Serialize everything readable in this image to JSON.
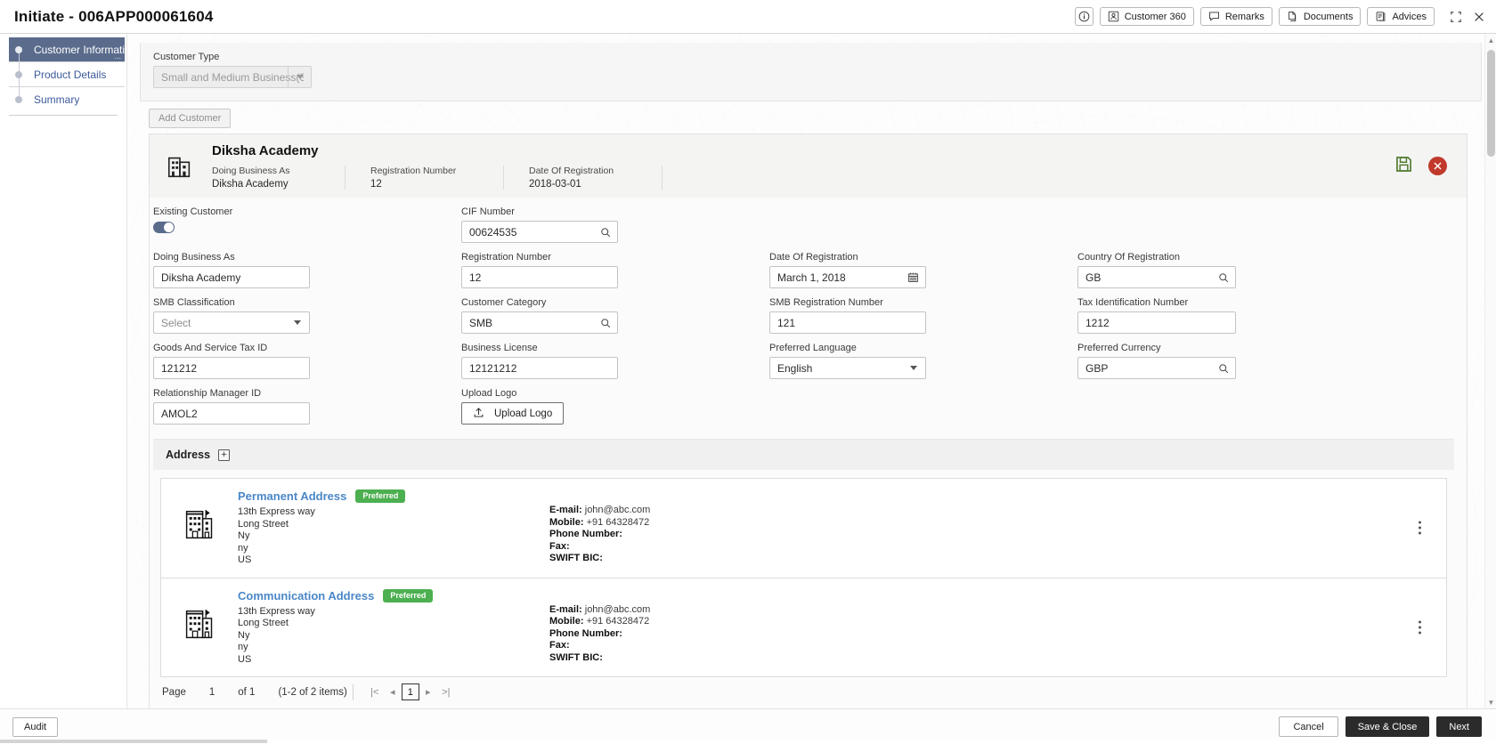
{
  "window": {
    "title": "Initiate - 006APP000061604",
    "actions": [
      {
        "label": "",
        "icon": "info-icon",
        "name": "info-button"
      },
      {
        "label": "Customer 360",
        "icon": "person-card-icon",
        "name": "customer-360-button"
      },
      {
        "label": "Remarks",
        "icon": "speech-bubble-icon",
        "name": "remarks-button"
      },
      {
        "label": "Documents",
        "icon": "documents-icon",
        "name": "documents-button"
      },
      {
        "label": "Advices",
        "icon": "clipboard-icon",
        "name": "advices-button"
      }
    ],
    "minimize_icon": "collapse-icon",
    "close_icon": "close-icon"
  },
  "sidebar": {
    "items": [
      {
        "label": "Customer Informati",
        "active": true
      },
      {
        "label": "Product Details",
        "active": false
      },
      {
        "label": "Summary",
        "active": false
      }
    ]
  },
  "form": {
    "customer_type_label": "Customer Type",
    "customer_type_value": "Small and Medium Business(S",
    "add_customer_label": "Add Customer"
  },
  "customer_card": {
    "name": "Diksha Academy",
    "meta": [
      {
        "key": "Doing Business As",
        "value": "Diksha Academy"
      },
      {
        "key": "Registration Number",
        "value": "12"
      },
      {
        "key": "Date Of Registration",
        "value": "2018-03-01"
      }
    ],
    "save_icon": "save-icon",
    "delete_icon": "delete-circle-icon",
    "fields": [
      {
        "label": "Existing Customer",
        "type": "toggle",
        "value": "on"
      },
      {
        "label": "CIF Number",
        "type": "search",
        "value": "00624535"
      },
      {
        "label": "",
        "type": "empty",
        "value": ""
      },
      {
        "label": "",
        "type": "empty",
        "value": ""
      },
      {
        "label": "Doing Business As",
        "type": "text",
        "value": "Diksha Academy"
      },
      {
        "label": "Registration Number",
        "type": "text",
        "value": "12"
      },
      {
        "label": "Date Of Registration",
        "type": "date",
        "value": "March 1, 2018"
      },
      {
        "label": "Country Of Registration",
        "type": "search",
        "value": "GB"
      },
      {
        "label": "SMB Classification",
        "type": "select",
        "value": "Select"
      },
      {
        "label": "Customer Category",
        "type": "search",
        "value": "SMB"
      },
      {
        "label": "SMB Registration Number",
        "type": "text",
        "value": "121"
      },
      {
        "label": "Tax Identification Number",
        "type": "text",
        "value": "1212"
      },
      {
        "label": "Goods And Service Tax ID",
        "type": "text",
        "value": "121212"
      },
      {
        "label": "Business License",
        "type": "text",
        "value": "12121212"
      },
      {
        "label": "Preferred Language",
        "type": "select",
        "value": "English"
      },
      {
        "label": "Preferred Currency",
        "type": "search",
        "value": "GBP"
      },
      {
        "label": "Relationship Manager ID",
        "type": "text",
        "value": "AMOL2"
      },
      {
        "label": "Upload Logo",
        "type": "upload",
        "value": "Upload Logo"
      },
      {
        "label": "",
        "type": "empty",
        "value": ""
      },
      {
        "label": "",
        "type": "empty",
        "value": ""
      }
    ]
  },
  "address": {
    "section_title": "Address",
    "add_icon": "plus-icon",
    "rows": [
      {
        "title": "Permanent Address",
        "badge": "Preferred",
        "lines": [
          "13th Express way",
          "Long Street",
          "Ny",
          "ny",
          "US"
        ],
        "contacts": [
          {
            "key": "E-mail:",
            "value": "john@abc.com"
          },
          {
            "key": "Mobile:",
            "value": "+91 64328472"
          },
          {
            "key": "Phone Number:",
            "value": ""
          },
          {
            "key": "Fax:",
            "value": ""
          },
          {
            "key": "SWIFT BIC:",
            "value": ""
          }
        ]
      },
      {
        "title": "Communication Address",
        "badge": "Preferred",
        "lines": [
          "13th Express way",
          "Long Street",
          "Ny",
          "ny",
          "US"
        ],
        "contacts": [
          {
            "key": "E-mail:",
            "value": "john@abc.com"
          },
          {
            "key": "Mobile:",
            "value": "+91 64328472"
          },
          {
            "key": "Phone Number:",
            "value": ""
          },
          {
            "key": "Fax:",
            "value": ""
          },
          {
            "key": "SWIFT BIC:",
            "value": ""
          }
        ]
      }
    ],
    "pager": {
      "page_label": "Page",
      "page_number": "1",
      "of_label": "of 1",
      "items_label": "(1-2 of 2 items)",
      "first": "|<",
      "prev": "◂",
      "current": "1",
      "next": "▸",
      "last": ">|"
    }
  },
  "footer": {
    "audit": "Audit",
    "cancel": "Cancel",
    "save_close": "Save & Close",
    "next": "Next"
  },
  "colors": {
    "accent_sidebar": "#5a6b8c",
    "link": "#4a87c7",
    "badge_green": "#4caf50",
    "delete_red": "#c0392b",
    "save_green": "#4e7a2e",
    "dark_button": "#2b2b2b"
  }
}
